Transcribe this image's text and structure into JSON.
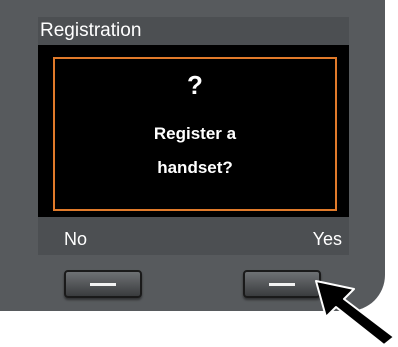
{
  "screen": {
    "title": "Registration",
    "dialog": {
      "symbol": "?",
      "line1": "Register a",
      "line2": "handset?"
    }
  },
  "softkeys": {
    "left_label": "No",
    "right_label": "Yes"
  },
  "colors": {
    "device_body": "#575a5d",
    "title_bar": "#4c4f52",
    "screen_background": "#000000",
    "dialog_frame": "#e07a2a",
    "text": "#ffffff"
  },
  "icons": {
    "pointer": "pointer-arrow-icon",
    "softkey_mark": "dash-icon"
  }
}
